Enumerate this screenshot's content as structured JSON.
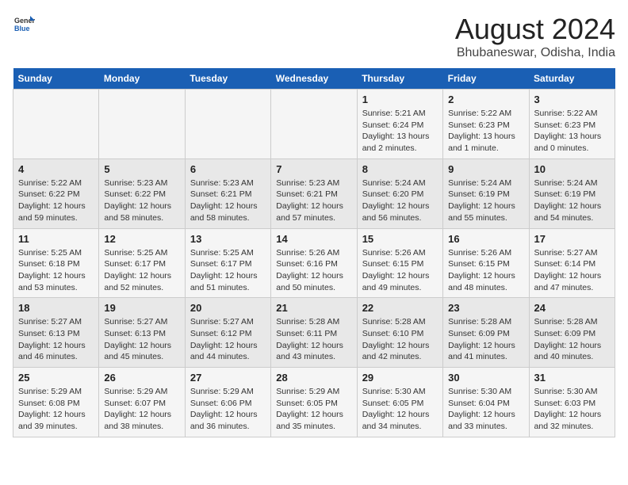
{
  "logo": {
    "line1": "General",
    "line2": "Blue"
  },
  "title": "August 2024",
  "subtitle": "Bhubaneswar, Odisha, India",
  "weekdays": [
    "Sunday",
    "Monday",
    "Tuesday",
    "Wednesday",
    "Thursday",
    "Friday",
    "Saturday"
  ],
  "weeks": [
    [
      {
        "day": "",
        "info": ""
      },
      {
        "day": "",
        "info": ""
      },
      {
        "day": "",
        "info": ""
      },
      {
        "day": "",
        "info": ""
      },
      {
        "day": "1",
        "info": "Sunrise: 5:21 AM\nSunset: 6:24 PM\nDaylight: 13 hours\nand 2 minutes."
      },
      {
        "day": "2",
        "info": "Sunrise: 5:22 AM\nSunset: 6:23 PM\nDaylight: 13 hours\nand 1 minute."
      },
      {
        "day": "3",
        "info": "Sunrise: 5:22 AM\nSunset: 6:23 PM\nDaylight: 13 hours\nand 0 minutes."
      }
    ],
    [
      {
        "day": "4",
        "info": "Sunrise: 5:22 AM\nSunset: 6:22 PM\nDaylight: 12 hours\nand 59 minutes."
      },
      {
        "day": "5",
        "info": "Sunrise: 5:23 AM\nSunset: 6:22 PM\nDaylight: 12 hours\nand 58 minutes."
      },
      {
        "day": "6",
        "info": "Sunrise: 5:23 AM\nSunset: 6:21 PM\nDaylight: 12 hours\nand 58 minutes."
      },
      {
        "day": "7",
        "info": "Sunrise: 5:23 AM\nSunset: 6:21 PM\nDaylight: 12 hours\nand 57 minutes."
      },
      {
        "day": "8",
        "info": "Sunrise: 5:24 AM\nSunset: 6:20 PM\nDaylight: 12 hours\nand 56 minutes."
      },
      {
        "day": "9",
        "info": "Sunrise: 5:24 AM\nSunset: 6:19 PM\nDaylight: 12 hours\nand 55 minutes."
      },
      {
        "day": "10",
        "info": "Sunrise: 5:24 AM\nSunset: 6:19 PM\nDaylight: 12 hours\nand 54 minutes."
      }
    ],
    [
      {
        "day": "11",
        "info": "Sunrise: 5:25 AM\nSunset: 6:18 PM\nDaylight: 12 hours\nand 53 minutes."
      },
      {
        "day": "12",
        "info": "Sunrise: 5:25 AM\nSunset: 6:17 PM\nDaylight: 12 hours\nand 52 minutes."
      },
      {
        "day": "13",
        "info": "Sunrise: 5:25 AM\nSunset: 6:17 PM\nDaylight: 12 hours\nand 51 minutes."
      },
      {
        "day": "14",
        "info": "Sunrise: 5:26 AM\nSunset: 6:16 PM\nDaylight: 12 hours\nand 50 minutes."
      },
      {
        "day": "15",
        "info": "Sunrise: 5:26 AM\nSunset: 6:15 PM\nDaylight: 12 hours\nand 49 minutes."
      },
      {
        "day": "16",
        "info": "Sunrise: 5:26 AM\nSunset: 6:15 PM\nDaylight: 12 hours\nand 48 minutes."
      },
      {
        "day": "17",
        "info": "Sunrise: 5:27 AM\nSunset: 6:14 PM\nDaylight: 12 hours\nand 47 minutes."
      }
    ],
    [
      {
        "day": "18",
        "info": "Sunrise: 5:27 AM\nSunset: 6:13 PM\nDaylight: 12 hours\nand 46 minutes."
      },
      {
        "day": "19",
        "info": "Sunrise: 5:27 AM\nSunset: 6:13 PM\nDaylight: 12 hours\nand 45 minutes."
      },
      {
        "day": "20",
        "info": "Sunrise: 5:27 AM\nSunset: 6:12 PM\nDaylight: 12 hours\nand 44 minutes."
      },
      {
        "day": "21",
        "info": "Sunrise: 5:28 AM\nSunset: 6:11 PM\nDaylight: 12 hours\nand 43 minutes."
      },
      {
        "day": "22",
        "info": "Sunrise: 5:28 AM\nSunset: 6:10 PM\nDaylight: 12 hours\nand 42 minutes."
      },
      {
        "day": "23",
        "info": "Sunrise: 5:28 AM\nSunset: 6:09 PM\nDaylight: 12 hours\nand 41 minutes."
      },
      {
        "day": "24",
        "info": "Sunrise: 5:28 AM\nSunset: 6:09 PM\nDaylight: 12 hours\nand 40 minutes."
      }
    ],
    [
      {
        "day": "25",
        "info": "Sunrise: 5:29 AM\nSunset: 6:08 PM\nDaylight: 12 hours\nand 39 minutes."
      },
      {
        "day": "26",
        "info": "Sunrise: 5:29 AM\nSunset: 6:07 PM\nDaylight: 12 hours\nand 38 minutes."
      },
      {
        "day": "27",
        "info": "Sunrise: 5:29 AM\nSunset: 6:06 PM\nDaylight: 12 hours\nand 36 minutes."
      },
      {
        "day": "28",
        "info": "Sunrise: 5:29 AM\nSunset: 6:05 PM\nDaylight: 12 hours\nand 35 minutes."
      },
      {
        "day": "29",
        "info": "Sunrise: 5:30 AM\nSunset: 6:05 PM\nDaylight: 12 hours\nand 34 minutes."
      },
      {
        "day": "30",
        "info": "Sunrise: 5:30 AM\nSunset: 6:04 PM\nDaylight: 12 hours\nand 33 minutes."
      },
      {
        "day": "31",
        "info": "Sunrise: 5:30 AM\nSunset: 6:03 PM\nDaylight: 12 hours\nand 32 minutes."
      }
    ]
  ]
}
